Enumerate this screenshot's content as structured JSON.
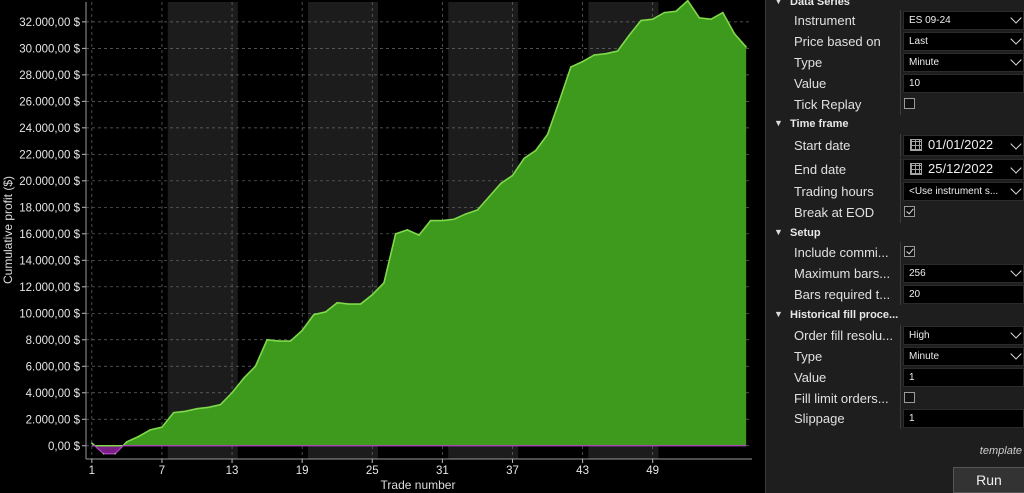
{
  "chart_data": {
    "type": "area",
    "xlabel": "Trade number",
    "ylabel": "Cumulative profit ($)",
    "x_ticks": [
      "1",
      "7",
      "13",
      "19",
      "25",
      "31",
      "37",
      "43",
      "49"
    ],
    "y_ticks": [
      "0,00 $",
      "2.000,00 $",
      "4.000,00 $",
      "6.000,00 $",
      "8.000,00 $",
      "10.000,00 $",
      "12.000,00 $",
      "14.000,00 $",
      "16.000,00 $",
      "18.000,00 $",
      "20.000,00 $",
      "22.000,00 $",
      "24.000,00 $",
      "26.000,00 $",
      "28.000,00 $",
      "30.000,00 $",
      "32.000,00 $"
    ],
    "ylim": [
      -1000,
      33500
    ],
    "xlim": [
      0.5,
      57.5
    ],
    "grid": true,
    "x": [
      1,
      2,
      3,
      4,
      5,
      6,
      7,
      8,
      9,
      10,
      11,
      12,
      13,
      14,
      15,
      16,
      17,
      18,
      19,
      20,
      21,
      22,
      23,
      24,
      25,
      26,
      27,
      28,
      29,
      30,
      31,
      32,
      33,
      34,
      35,
      36,
      37,
      38,
      39,
      40,
      41,
      42,
      43,
      44,
      45,
      46,
      47,
      48,
      49,
      50,
      51,
      52,
      53,
      54,
      55,
      56,
      57
    ],
    "values": [
      200,
      -600,
      -600,
      300,
      700,
      1200,
      1400,
      2500,
      2600,
      2800,
      2900,
      3100,
      4000,
      5100,
      6000,
      8000,
      7900,
      7900,
      8700,
      9900,
      10100,
      10800,
      10700,
      10700,
      11400,
      12300,
      16000,
      16300,
      15900,
      17000,
      17000,
      17100,
      17500,
      17800,
      18800,
      19800,
      20400,
      21700,
      22300,
      23500,
      26000,
      28600,
      29000,
      29500,
      29600,
      29800,
      31000,
      32100,
      32200,
      32700,
      32800,
      33600,
      32300,
      32200,
      32700,
      31100,
      30100
    ],
    "series_colors": {
      "profit": "#3d9a1d",
      "profit_line": "#7fd94a",
      "loss": "#7a1f86",
      "loss_line": "#b33fc7"
    },
    "band_colors": [
      "#000000",
      "#1c1c1c"
    ]
  },
  "panel": {
    "data_series": {
      "title": "Data Series",
      "rows": [
        {
          "label": "Instrument",
          "value": "ES 09-24"
        },
        {
          "label": "Price based on",
          "value": "Last"
        },
        {
          "label": "Type",
          "value": "Minute"
        },
        {
          "label": "Value",
          "value": "10"
        },
        {
          "label": "Tick Replay",
          "checked": false
        }
      ]
    },
    "time_frame": {
      "title": "Time frame",
      "rows": [
        {
          "label": "Start date",
          "value": "01/01/2022"
        },
        {
          "label": "End date",
          "value": "25/12/2022"
        },
        {
          "label": "Trading hours",
          "value": "<Use instrument s..."
        },
        {
          "label": "Break at EOD",
          "checked": true
        }
      ]
    },
    "setup": {
      "title": "Setup",
      "rows": [
        {
          "label": "Include commi...",
          "checked": true
        },
        {
          "label": "Maximum bars...",
          "value": "256"
        },
        {
          "label": "Bars required t...",
          "value": "20"
        }
      ]
    },
    "historical_fill": {
      "title": "Historical fill proce...",
      "rows": [
        {
          "label": "Order fill resolu...",
          "value": "High"
        },
        {
          "label": "Type",
          "value": "Minute"
        },
        {
          "label": "Value",
          "value": "1"
        },
        {
          "label": "Fill limit orders...",
          "checked": false
        },
        {
          "label": "Slippage",
          "value": "1"
        }
      ]
    },
    "template_label": "template",
    "run_label": "Run"
  }
}
